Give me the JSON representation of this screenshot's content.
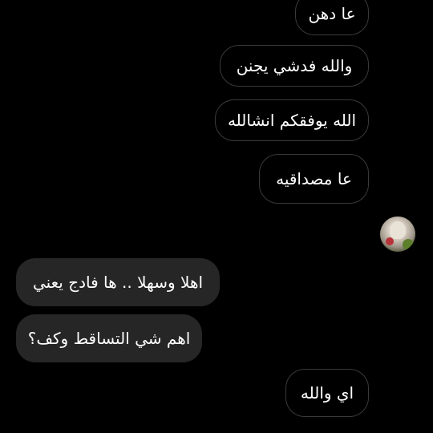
{
  "messages": {
    "out1": "عا دهن",
    "out2": "والله فدشي يجنن",
    "out3": "الله يوفقكم انشالله",
    "out4": "عا مصداقيه",
    "reaction": "😘😘",
    "in1": "اهلا وسهلا .. ها فادج يعني",
    "in2": "اهم شي التساقط وكف؟",
    "out5": "اي والله"
  },
  "colors": {
    "background": "#000000",
    "outgoing_border": "#3a3a3a",
    "incoming_bubble": "#262626",
    "text": "#ffffff"
  }
}
